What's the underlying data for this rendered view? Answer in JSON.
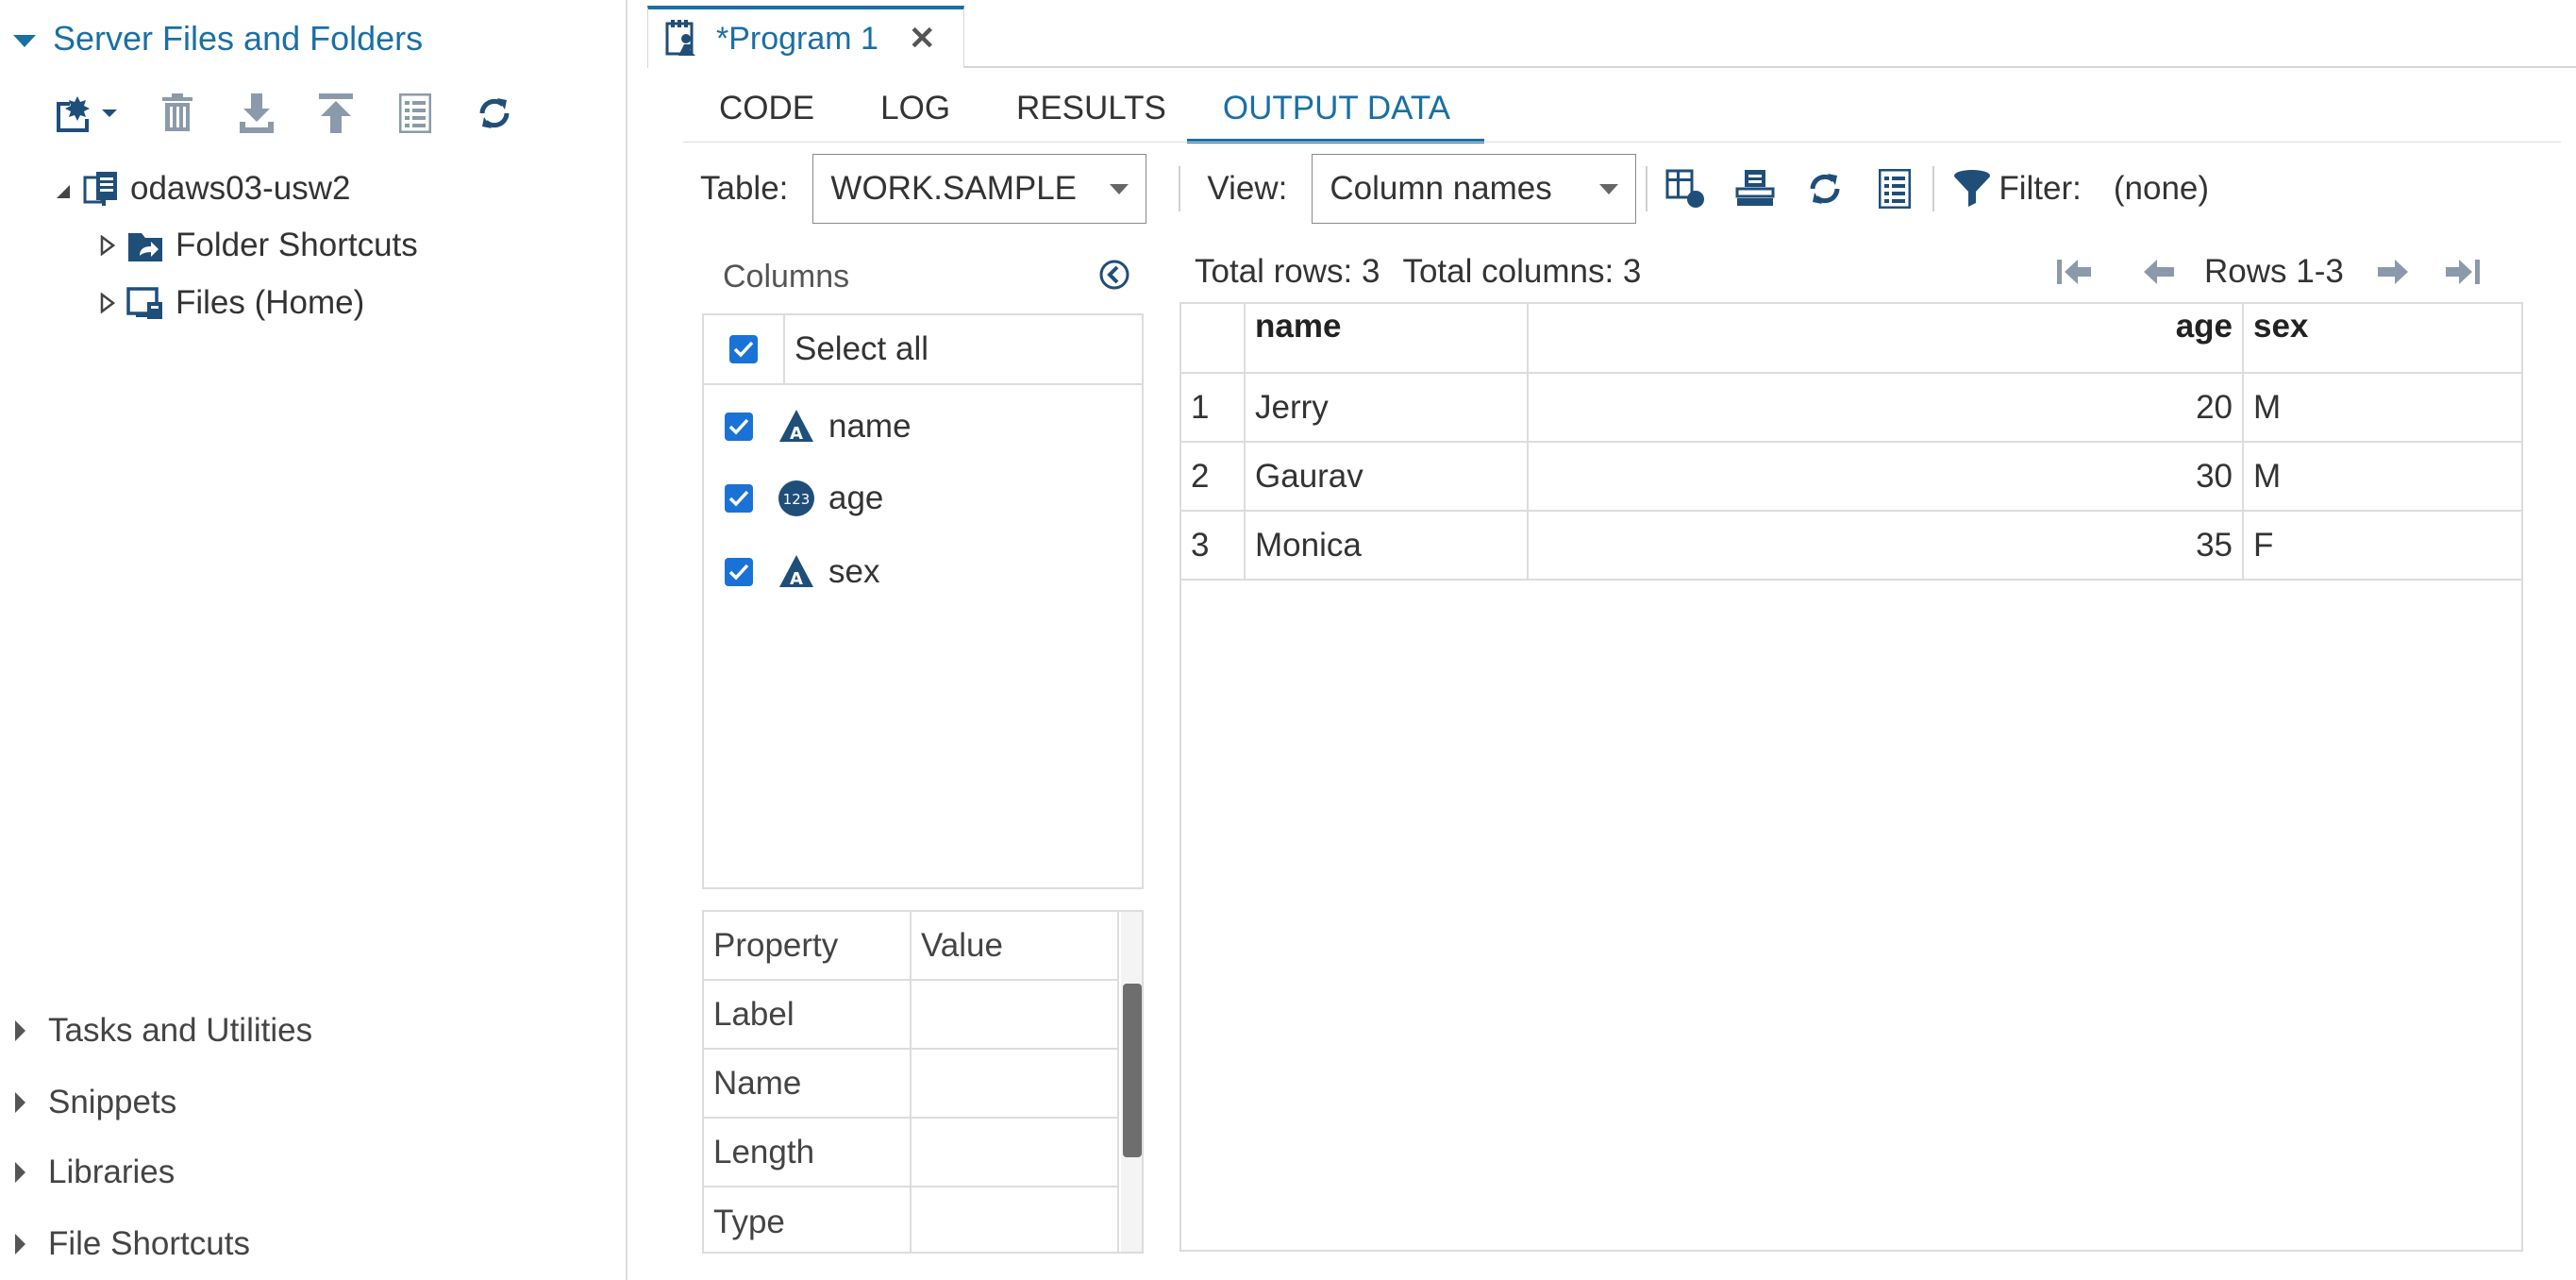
{
  "nav": {
    "section_title": "Server Files and Folders",
    "toolbar_icons": [
      "new-menu-icon",
      "delete-icon",
      "download-icon",
      "upload-icon",
      "properties-icon",
      "refresh-icon"
    ],
    "tree": {
      "server": "odaws03-usw2",
      "children": [
        "Folder Shortcuts",
        "Files (Home)"
      ]
    },
    "bottom_sections": [
      "Tasks and Utilities",
      "Snippets",
      "Libraries",
      "File Shortcuts"
    ]
  },
  "program_tab": {
    "title": "*Program 1",
    "close": "✕"
  },
  "sub_tabs": [
    "CODE",
    "LOG",
    "RESULTS",
    "OUTPUT DATA"
  ],
  "active_sub_tab": "OUTPUT DATA",
  "toolbar": {
    "table_label": "Table:",
    "table_value": "WORK.SAMPLE",
    "view_label": "View:",
    "view_value": "Column names",
    "filter_label": "Filter:",
    "filter_value": "(none)"
  },
  "columns_panel": {
    "title": "Columns",
    "select_all": "Select all",
    "items": [
      {
        "name": "name",
        "type": "char",
        "checked": true
      },
      {
        "name": "age",
        "type": "numeric",
        "checked": true
      },
      {
        "name": "sex",
        "type": "char",
        "checked": true
      }
    ]
  },
  "properties": {
    "headers": [
      "Property",
      "Value"
    ],
    "rows": [
      "Label",
      "Name",
      "Length",
      "Type"
    ]
  },
  "grid": {
    "total_rows": "Total rows: 3",
    "total_columns": "Total columns: 3",
    "rows_range": "Rows 1-3",
    "columns": [
      "name",
      "age",
      "sex"
    ],
    "rows": [
      [
        "1",
        "Jerry",
        "20",
        "M"
      ],
      [
        "2",
        "Gaurav",
        "30",
        "M"
      ],
      [
        "3",
        "Monica",
        "35",
        "F"
      ]
    ]
  },
  "colors": {
    "accent": "#1a6fa5",
    "checkbox": "#1a72d6",
    "icon": "#1f4e79"
  }
}
